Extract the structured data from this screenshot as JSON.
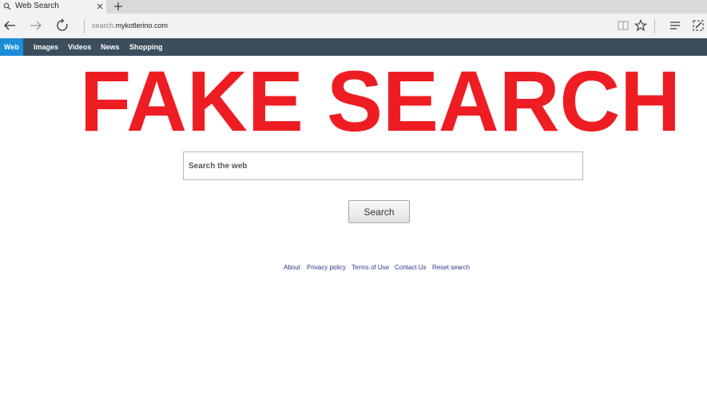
{
  "browser": {
    "tab": {
      "title": "Web Search"
    },
    "address": {
      "prefix": "search.",
      "domain": "mykotlerino.com"
    }
  },
  "nav": {
    "items": [
      {
        "label": "Web",
        "active": true
      },
      {
        "label": "Images",
        "active": false
      },
      {
        "label": "Videos",
        "active": false
      },
      {
        "label": "News",
        "active": false
      },
      {
        "label": "Shopping",
        "active": false
      }
    ]
  },
  "banner": {
    "text": "FAKE SEARCH",
    "color": "#ee1d23"
  },
  "search": {
    "placeholder": "Search the web",
    "value": "",
    "button_label": "Search"
  },
  "footer": {
    "links": [
      "About",
      "Privacy policy",
      "Terms of Use",
      "Contact Us",
      "Reset search"
    ]
  },
  "colors": {
    "nav_bar": "#3c4d5b",
    "nav_active": "#1d8dd8",
    "link": "#2a3a8a"
  },
  "icons": [
    "search-icon",
    "close-icon",
    "plus-icon",
    "back-arrow-icon",
    "forward-arrow-icon",
    "refresh-icon",
    "reading-view-icon",
    "star-icon",
    "hub-icon",
    "note-icon"
  ]
}
